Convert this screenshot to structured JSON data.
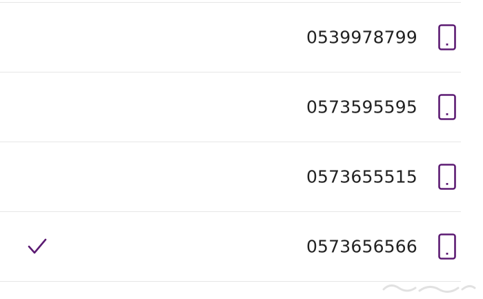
{
  "accent_color": "#5b1a72",
  "numbers": [
    {
      "value": "0539978799",
      "selected": false,
      "icon": "mobile-phone-icon"
    },
    {
      "value": "0573595595",
      "selected": false,
      "icon": "mobile-phone-icon"
    },
    {
      "value": "0573655515",
      "selected": false,
      "icon": "mobile-phone-icon"
    },
    {
      "value": "0573656566",
      "selected": true,
      "icon": "mobile-phone-icon"
    }
  ],
  "selected_icon": "checkmark-icon",
  "watermark_icon": "watermark-logo-icon"
}
